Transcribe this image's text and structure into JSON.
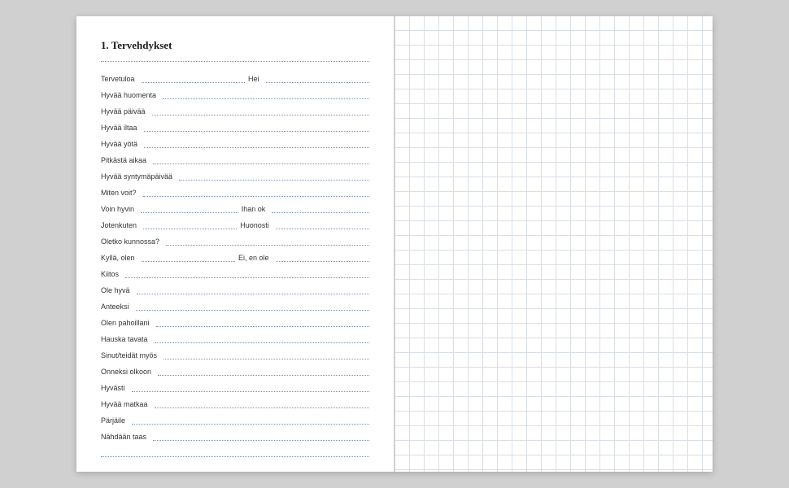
{
  "heading": "1. Tervehdykset",
  "rows": [
    {
      "left": "Tervetuloa",
      "right": "Hei"
    },
    {
      "left": "Hyvää huomenta"
    },
    {
      "left": "Hyvää päivää"
    },
    {
      "left": "Hyvää iltaa"
    },
    {
      "left": "Hyvää yötä"
    },
    {
      "left": "Pitkästä aikaa"
    },
    {
      "left": "Hyvää syntymäpäivää"
    },
    {
      "left": "Miten voit?"
    },
    {
      "left": "Voin hyvin",
      "right": "Ihan ok"
    },
    {
      "left": "Jotenkuten",
      "right": "Huonosti"
    },
    {
      "left": "Oletko kunnossa?"
    },
    {
      "left": "Kyllä, olen",
      "right": "Ei, en ole"
    },
    {
      "left": "Kiitos"
    },
    {
      "left": "Ole hyvä"
    },
    {
      "left": "Anteeksi"
    },
    {
      "left": "Olen pahoillani"
    },
    {
      "left": "Hauska tavata"
    },
    {
      "left": "Sinut/teidät myös"
    },
    {
      "left": "Onneksi olkoon"
    },
    {
      "left": "Hyvästi"
    },
    {
      "left": "Hyvää matkaa"
    },
    {
      "left": "Pärjäile"
    },
    {
      "left": "Nähdään taas"
    }
  ]
}
